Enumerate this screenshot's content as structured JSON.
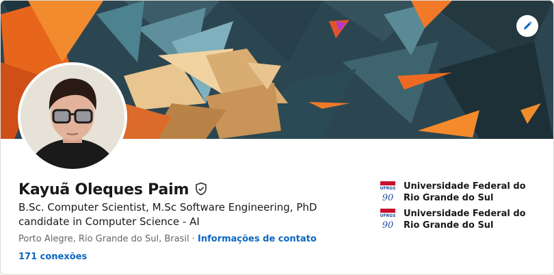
{
  "profile": {
    "name": "Kayuã Oleques Paim",
    "headline": "B.Sc. Computer Scientist, M.Sc Software Engineering, PhD candidate in Computer Science - AI",
    "location": "Porto Alegre, Rio Grande do Sul, Brasil",
    "separator": " · ",
    "contact_link": "Informações de contato",
    "connections": "171 conexões"
  },
  "education": [
    {
      "name": "Universidade Federal do Rio Grande do Sul",
      "logo_text": "UFRGS",
      "logo_number": "90"
    },
    {
      "name": "Universidade Federal do Rio Grande do Sul",
      "logo_text": "UFRGS",
      "logo_number": "90"
    }
  ],
  "icons": {
    "edit_banner": "pencil-icon",
    "verified": "shield-check-icon"
  },
  "colors": {
    "link": "#0a66c2",
    "text_primary": "#191919",
    "text_secondary": "#666666",
    "banner_teal": "#2f4a55",
    "banner_orange": "#f07a28",
    "banner_cream": "#e9c58f"
  }
}
